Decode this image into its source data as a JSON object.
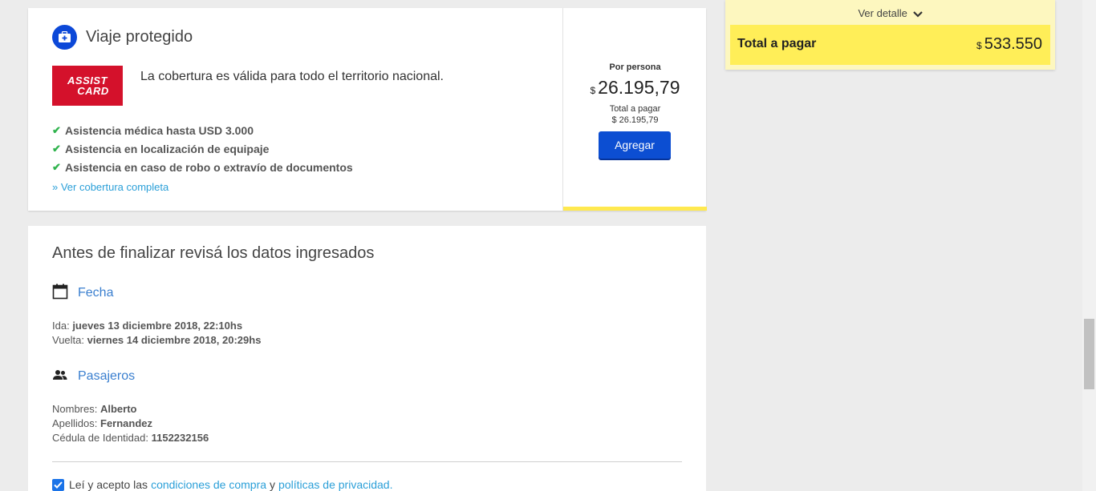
{
  "insurance": {
    "title": "Viaje protegido",
    "logo_line1": "ASSIST",
    "logo_line2": "CARD",
    "description": "La cobertura es válida para todo el territorio nacional.",
    "features": [
      "Asistencia médica hasta USD 3.000",
      "Asistencia en localización de equipaje",
      "Asistencia en caso de robo o extravío de documentos"
    ],
    "more_link": "» Ver cobertura completa",
    "per_person_label": "Por persona",
    "currency": "$",
    "price": "26.195,79",
    "total_label": "Total a pagar",
    "total_value": "$ 26.195,79",
    "add_button": "Agregar"
  },
  "review": {
    "title": "Antes de finalizar revisá los datos ingresados",
    "date_section": {
      "title": "Fecha",
      "ida_label": "Ida:",
      "ida_value": "jueves 13 diciembre 2018, 22:10hs",
      "vuelta_label": "Vuelta:",
      "vuelta_value": "viernes 14 diciembre 2018, 20:29hs"
    },
    "passengers_section": {
      "title": "Pasajeros",
      "names_label": "Nombres:",
      "names_value": "Alberto",
      "surnames_label": "Apellidos:",
      "surnames_value": "Fernandez",
      "id_label": "Cédula de Identidad:",
      "id_value": "1152232156"
    },
    "accept": {
      "prefix": "Leí y acepto las",
      "terms_link": "condiciones de compra",
      "and": "y",
      "privacy_link": "políticas de privacidad."
    }
  },
  "summary": {
    "detail_link": "Ver detalle",
    "total_label": "Total a pagar",
    "currency": "$",
    "total_value": "533.550"
  },
  "colors": {
    "accent_blue": "#0c4ed2",
    "link_blue": "#2a9fd8",
    "yellow": "#ffee58",
    "assist_red": "#d4112b",
    "check_green": "#2fb34d"
  }
}
